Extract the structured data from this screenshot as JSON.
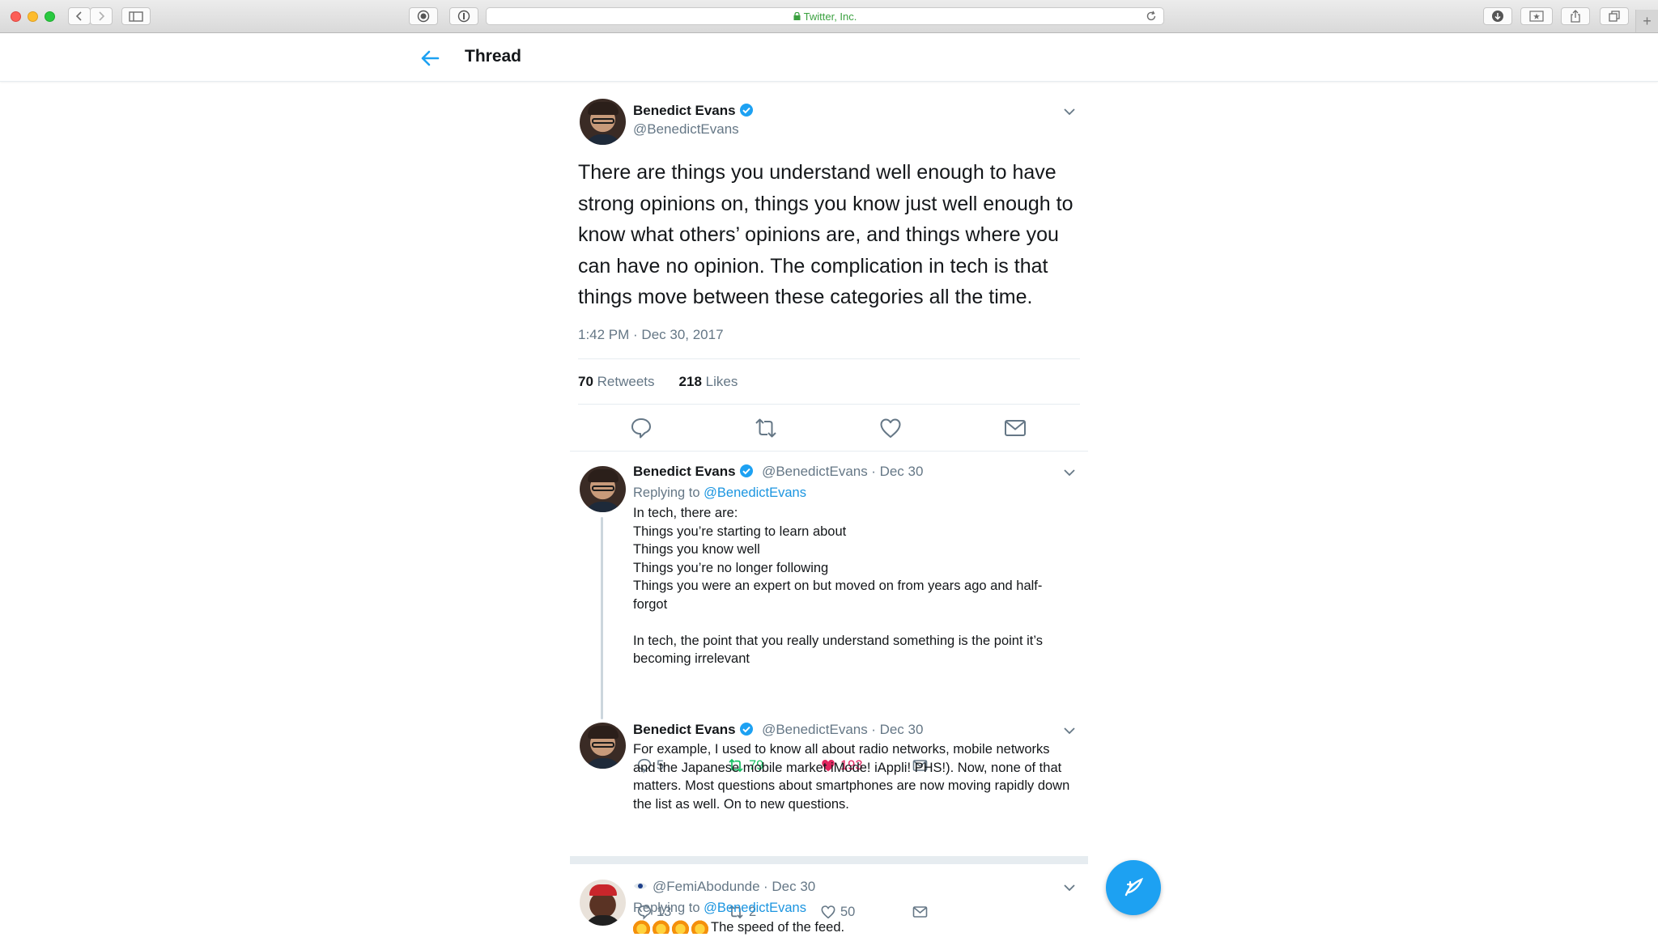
{
  "browser": {
    "address": "Twitter, Inc."
  },
  "header": {
    "title": "Thread"
  },
  "main_tweet": {
    "name": "Benedict Evans",
    "handle": "@BenedictEvans",
    "text": "There are things you understand well enough to have strong opinions on, things you know just well enough to know what others’ opinions are, and things where you can have no opinion. The complication in tech is that things move between these categories all the time.",
    "timestamp": "1:42 PM · Dec 30, 2017",
    "retweets_count": "70",
    "retweets_label": "Retweets",
    "likes_count": "218",
    "likes_label": "Likes"
  },
  "replies": [
    {
      "name": "Benedict Evans",
      "handle": "@BenedictEvans",
      "date": "· Dec 30",
      "replying_label": "Replying to",
      "replying_to": "@BenedictEvans",
      "lines": [
        "In tech, there are:",
        "Things you’re starting to learn about",
        "Things you know well",
        "Things you’re no longer following",
        "Things you were an expert on but moved on from years ago and half-forgot",
        "",
        "In tech, the point that you really understand something is the point it’s becoming irrelevant"
      ],
      "reply_count": "5",
      "retweet_count": "79",
      "like_count": "193"
    },
    {
      "name": "Benedict Evans",
      "handle": "@BenedictEvans",
      "date": "· Dec 30",
      "text": "For example, I used to know all about radio networks, mobile networks and the Japanese mobile market iMode! iAppli! PHS!). Now, none of that matters. Most questions about smartphones are now moving rapidly down the list as well. On to new questions.",
      "reply_count": "13",
      "retweet_count": "2",
      "like_count": "50"
    },
    {
      "handle": "@FemiAbodunde",
      "date": "· Dec 30",
      "replying_label": "Replying to",
      "replying_to": "@BenedictEvans",
      "text": "The speed of the feed."
    }
  ],
  "colors": {
    "accent": "#1da1f2",
    "retweet_active": "#17bf63",
    "like_active": "#e0245e",
    "secondary_text": "#657786"
  },
  "icons": [
    "back-arrow-icon",
    "verified-icon",
    "chevron-down-icon",
    "reply-icon",
    "retweet-icon",
    "like-icon",
    "message-icon",
    "compose-icon",
    "fire-emoji-icon",
    "eye-icon"
  ]
}
